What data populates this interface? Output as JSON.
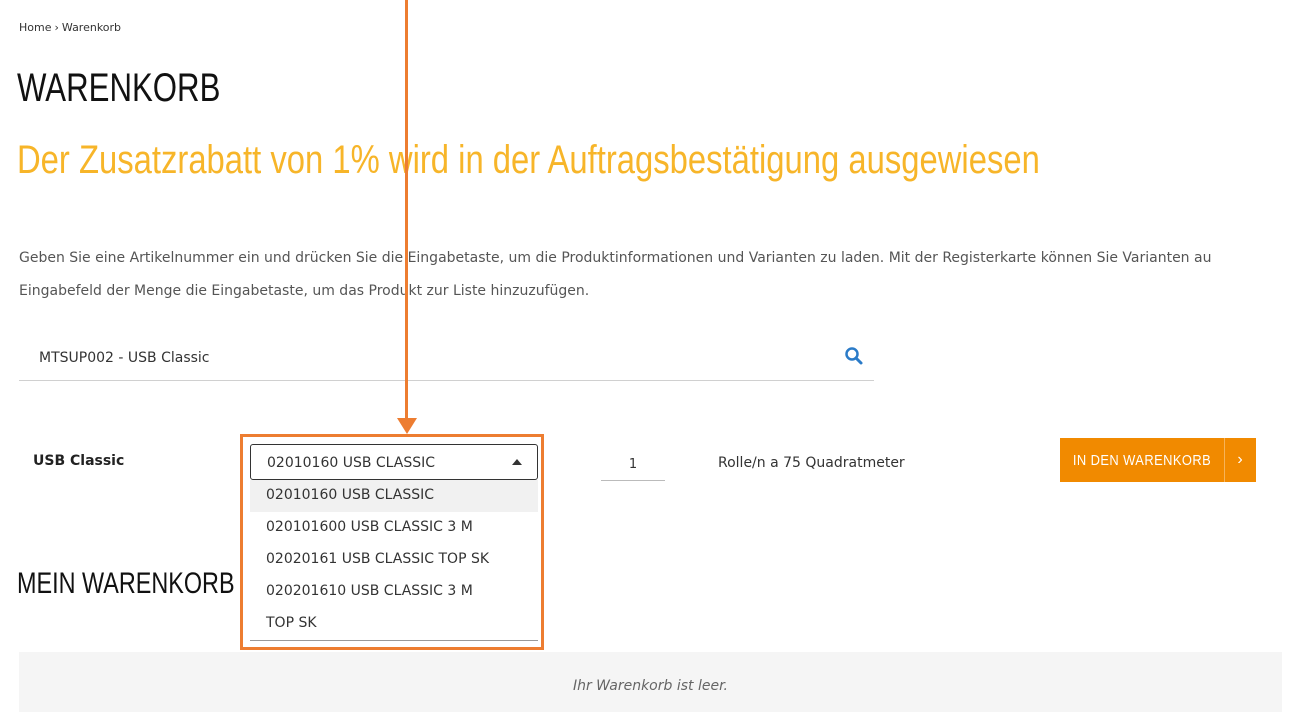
{
  "breadcrumb": {
    "home": "Home",
    "separator": "›",
    "current": "Warenkorb"
  },
  "page_title": "WARENKORB",
  "promo_text": "Der Zusatzrabatt von 1% wird in der Auftragsbestätigung ausgewiesen",
  "intro": {
    "line1": "Geben Sie eine Artikelnummer ein und drücken Sie die Eingabetaste, um die Produktinformationen und Varianten zu laden. Mit der Registerkarte können Sie Varianten au",
    "line2": "Eingabefeld der Menge die Eingabetaste, um das Produkt zur Liste hinzuzufügen."
  },
  "search": {
    "value": "MTSUP002 - USB Classic",
    "icon": "search-icon"
  },
  "product": {
    "name": "USB Classic",
    "variant_selected": "02010160 USB CLASSIC",
    "variant_options": [
      "02010160 USB CLASSIC",
      "020101600 USB CLASSIC 3 M",
      "02020161 USB CLASSIC TOP SK",
      "020201610 USB CLASSIC 3 M",
      "TOP SK"
    ],
    "quantity": "1",
    "unit": "Rolle/n a 75 Quadratmeter",
    "add_button": "IN DEN WARENKORB",
    "add_button_chevron": "›"
  },
  "cart": {
    "title": "MEIN WARENKORB",
    "empty_text": "Ihr Warenkorb ist leer."
  },
  "colors": {
    "accent_orange": "#f18a00",
    "promo_yellow": "#f7b529",
    "annotation": "#ed7d31"
  }
}
